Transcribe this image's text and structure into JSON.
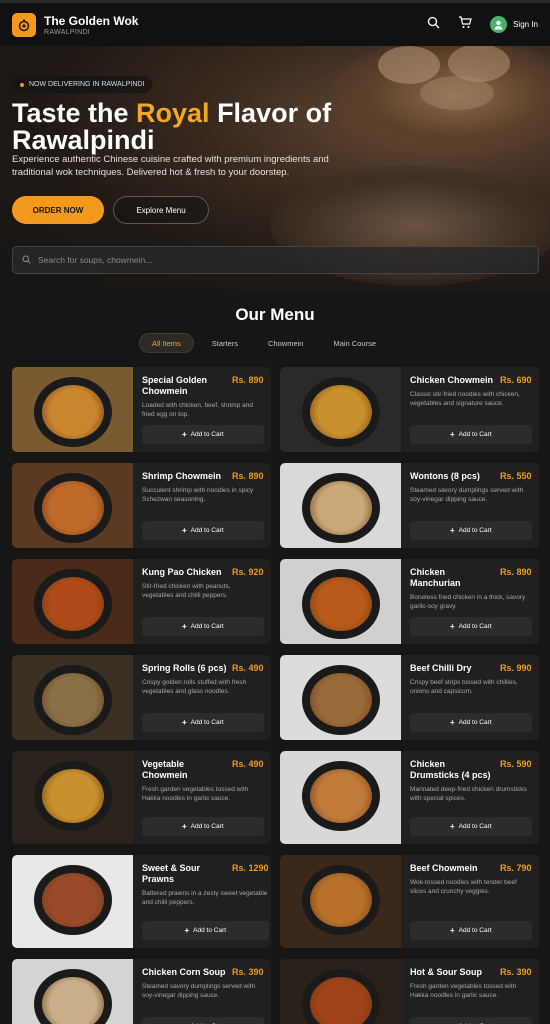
{
  "header": {
    "brand_name": "The Golden Wok",
    "brand_sub": "RAWALPINDI",
    "icons": [
      "search-icon",
      "cart-icon",
      "user-icon"
    ],
    "signin_label": "Sign In"
  },
  "hero": {
    "badge": "NOW DELIVERING IN RAWALPINDI",
    "title_part1": "Taste the ",
    "title_accent": "Royal",
    "title_part2": " Flavor of Rawalpindi",
    "description": "Experience authentic Chinese cuisine crafted with premium ingredients and traditional wok techniques. Delivered hot & fresh to your doorstep.",
    "order_button": "ORDER NOW",
    "explore_button": "Explore Menu",
    "search_placeholder": "Search for soups, chowmein..."
  },
  "menu": {
    "title": "Our Menu",
    "tabs": [
      "All Items",
      "Starters",
      "Chowmein",
      "Main Course"
    ],
    "active_tab": "All Items",
    "add_to_cart_label": "Add to Cart",
    "items": [
      {
        "name": "Special Golden Chowmein",
        "price": "Rs. 890",
        "desc": "Loaded with chicken, beef, shrimp and fried egg on top."
      },
      {
        "name": "Chicken Chowmein",
        "price": "Rs. 690",
        "desc": "Classic stir-fried noodles with chicken, vegetables and signature sauce."
      },
      {
        "name": "Shrimp Chowmein",
        "price": "Rs. 890",
        "desc": "Succulent shrimp with noodles in spicy Schezwan seasoning."
      },
      {
        "name": "Wontons (8 pcs)",
        "price": "Rs. 550",
        "desc": "Steamed savory dumplings served with soy-vinegar dipping sauce."
      },
      {
        "name": "Kung Pao Chicken",
        "price": "Rs. 920",
        "desc": "Stir-fried chicken with peanuts, vegetables and chilli peppers."
      },
      {
        "name": "Chicken Manchurian",
        "price": "Rs. 890",
        "desc": "Boneless fried chicken in a thick, savory garlic-soy gravy."
      },
      {
        "name": "Spring Rolls (6 pcs)",
        "price": "Rs. 490",
        "desc": "Crispy golden rolls stuffed with fresh vegetables and glass noodles."
      },
      {
        "name": "Beef Chilli Dry",
        "price": "Rs. 990",
        "desc": "Crispy beef strips tossed with chillies, onions and capsicum."
      },
      {
        "name": "Vegetable Chowmein",
        "price": "Rs. 490",
        "desc": "Fresh garden vegetables tossed with Hakka noodles in garlic sauce."
      },
      {
        "name": "Chicken Drumsticks (4 pcs)",
        "price": "Rs. 590",
        "desc": "Marinated deep-fried chicken drumsticks with special spices."
      },
      {
        "name": "Sweet & Sour Prawns",
        "price": "Rs. 1290",
        "desc": "Battered prawns in a zesty sweet vegetable and chilli peppers."
      },
      {
        "name": "Beef Chowmein",
        "price": "Rs. 790",
        "desc": "Wok-tossed noodles with tender beef slices and crunchy veggies."
      },
      {
        "name": "Chicken Corn Soup",
        "price": "Rs. 390",
        "desc": "Steamed savory dumplings served with soy-vinegar dipping sauce."
      },
      {
        "name": "Hot & Sour Soup",
        "price": "Rs. 390",
        "desc": "Fresh garden vegetables tossed with Hakka noodles in garlic sauce."
      }
    ]
  },
  "colors": {
    "accent": "#f39a1e",
    "background": "#161616",
    "card": "#202020"
  }
}
